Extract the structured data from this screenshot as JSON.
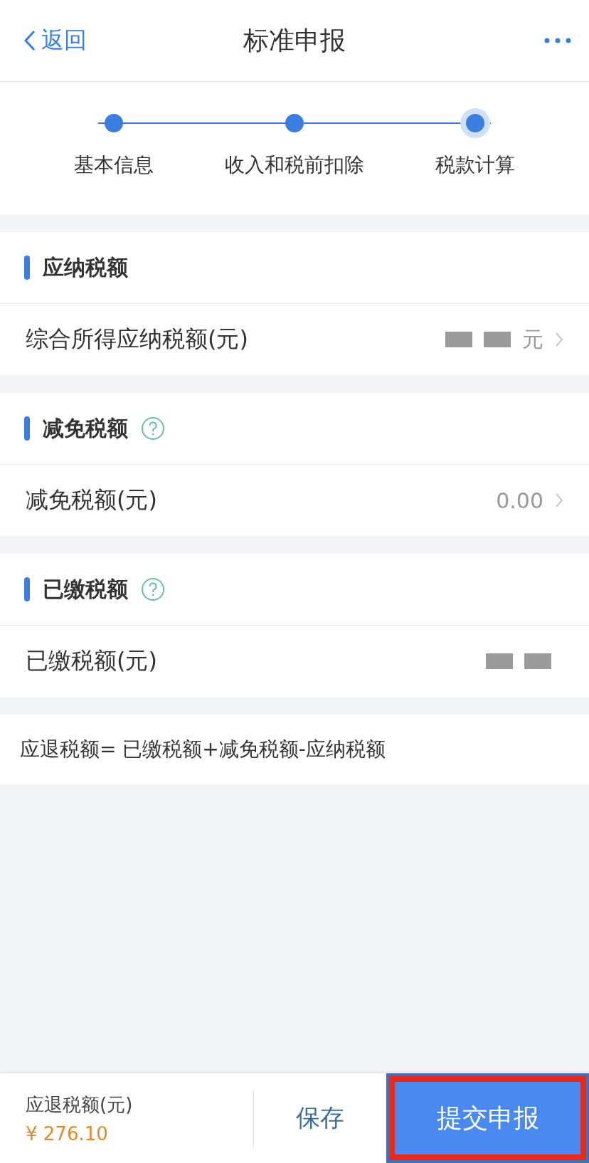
{
  "nav": {
    "back_label": "返回",
    "title": "标准申报"
  },
  "steps": [
    {
      "label": "基本信息",
      "current": false
    },
    {
      "label": "收入和税前扣除",
      "current": false
    },
    {
      "label": "税款计算",
      "current": true
    }
  ],
  "sections": [
    {
      "title": "应纳税额",
      "help": false,
      "row": {
        "label": "综合所得应纳税额(元)",
        "value": "元",
        "redacted": true,
        "arrow": true
      }
    },
    {
      "title": "减免税额",
      "help": true,
      "row": {
        "label": "减免税额(元)",
        "value": "0.00",
        "redacted": false,
        "arrow": true
      }
    },
    {
      "title": "已缴税额",
      "help": true,
      "row": {
        "label": "已缴税额(元)",
        "redacted": true,
        "arrow": false
      }
    }
  ],
  "formula": "应退税额= 已缴税额+减免税额-应纳税额",
  "footer": {
    "label": "应退税额(元)",
    "amount": "¥ 276.10",
    "save": "保存",
    "submit": "提交申报",
    "submit_highlighted": true
  }
}
